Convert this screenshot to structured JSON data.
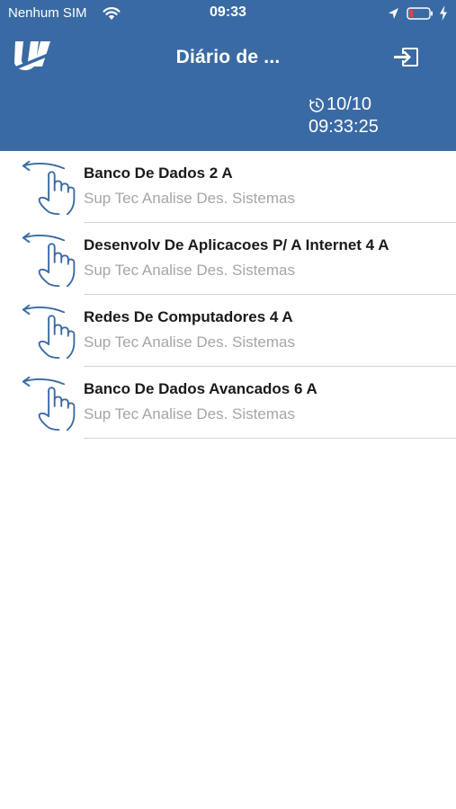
{
  "status_bar": {
    "carrier": "Nenhum SIM",
    "time": "09:33"
  },
  "header": {
    "title": "Diário de ...",
    "date": "10/10",
    "time": "09:33:25",
    "icons": [
      "logo-icon",
      "logout-icon",
      "timer-icon"
    ]
  },
  "classes": [
    {
      "title": "Banco De Dados 2 A",
      "course": "Sup Tec Analise Des. Sistemas"
    },
    {
      "title": "Desenvolv De Aplicacoes P/ A Internet 4 A",
      "course": "Sup Tec Analise Des. Sistemas"
    },
    {
      "title": "Redes De Computadores 4 A",
      "course": "Sup Tec Analise Des. Sistemas"
    },
    {
      "title": "Banco De Dados Avancados 6 A",
      "course": "Sup Tec Analise Des. Sistemas"
    }
  ],
  "colors": {
    "header_bg": "#3a6aa3",
    "swipe_icon": "#3a6aa3",
    "subtitle": "#a6a6a6",
    "battery_low": "#e5413c"
  }
}
